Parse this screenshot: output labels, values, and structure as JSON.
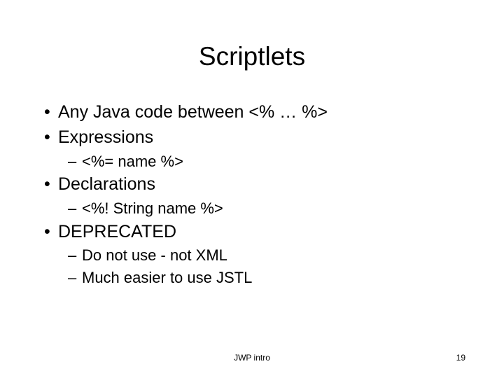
{
  "title": "Scriptlets",
  "bullets": {
    "b1": "Any Java code between <% … %>",
    "b2": "Expressions",
    "b2_1": "<%= name %>",
    "b3": "Declarations",
    "b3_1": "<%! String name %>",
    "b4": "DEPRECATED",
    "b4_1": "Do not use - not XML",
    "b4_2": "Much easier to use JSTL"
  },
  "footer": {
    "center": "JWP intro",
    "page": "19"
  }
}
